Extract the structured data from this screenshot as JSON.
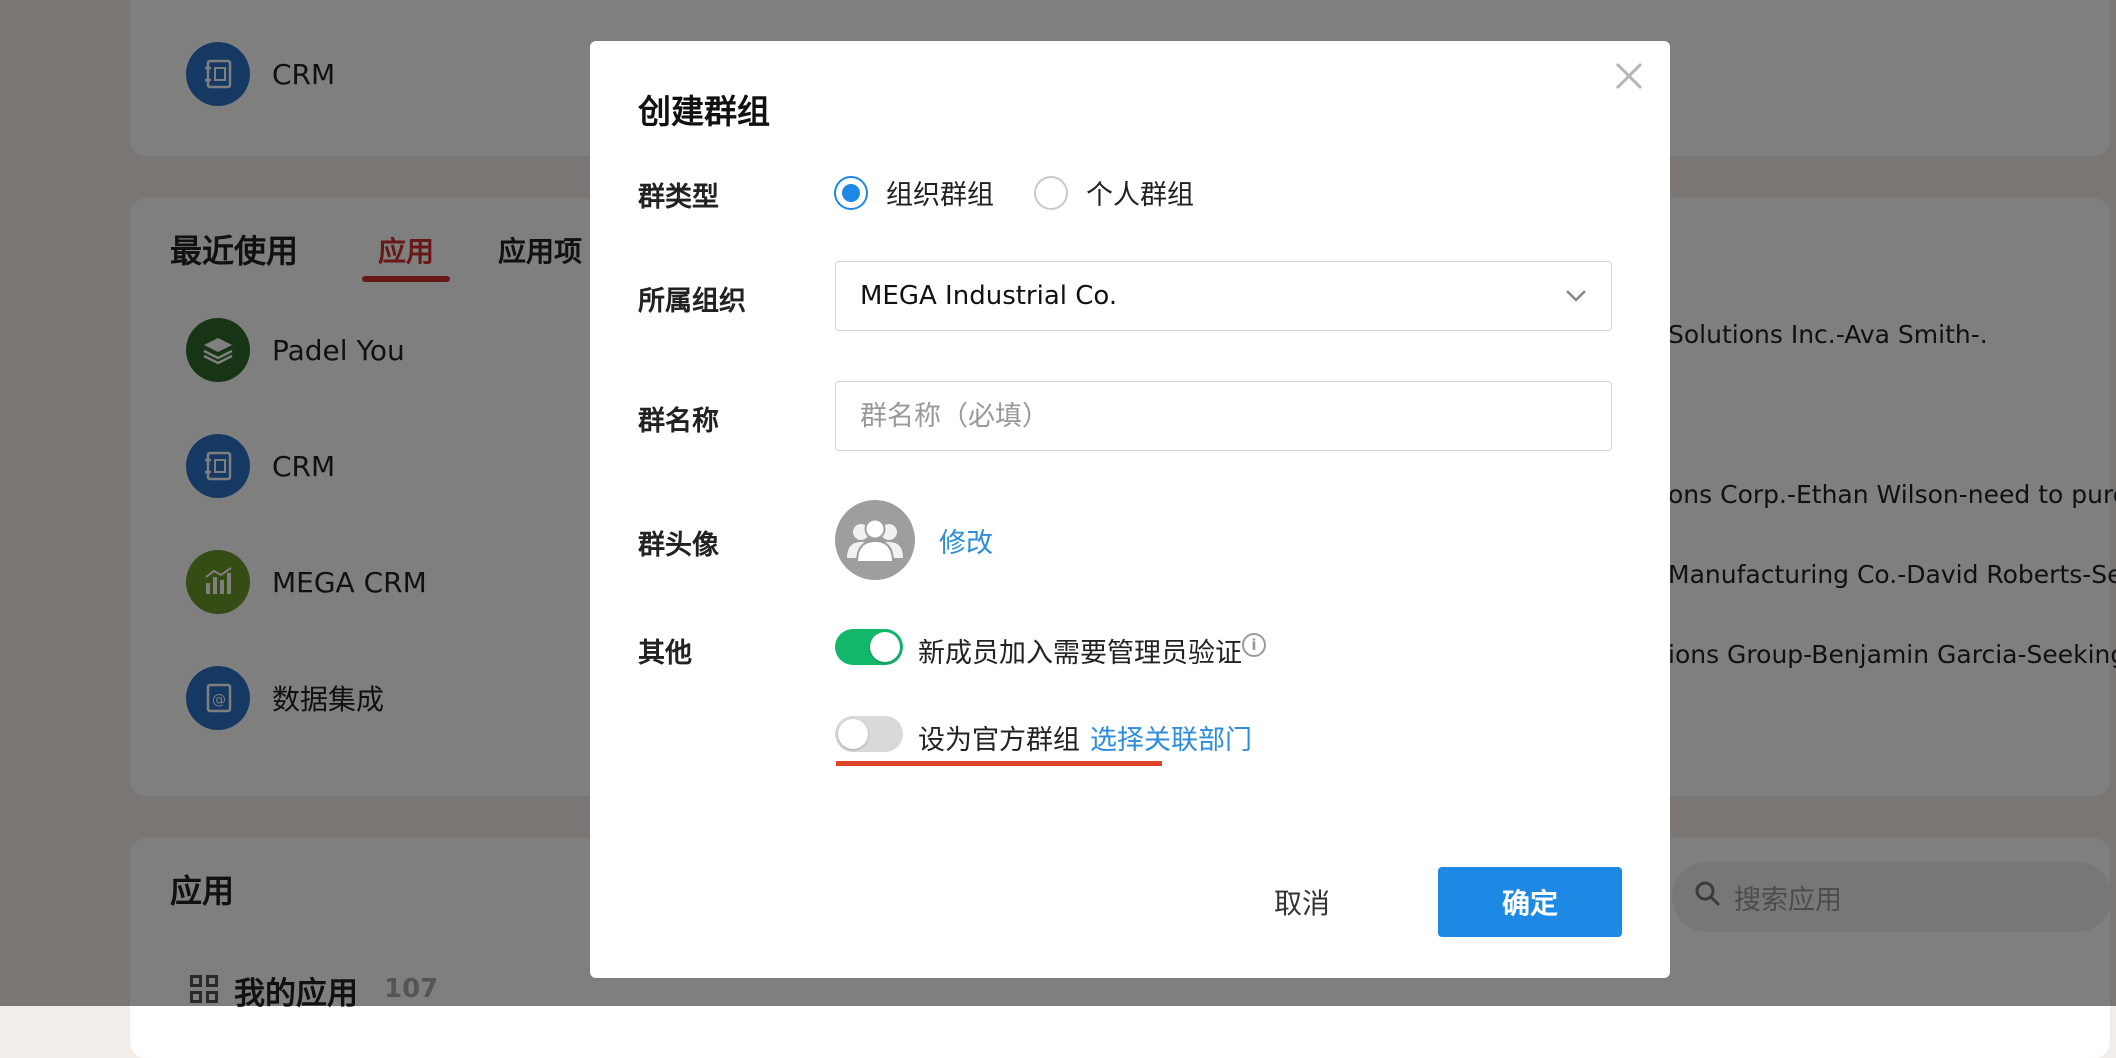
{
  "background": {
    "top_app": {
      "label": "CRM",
      "icon": "ledger-icon",
      "color": "#2b72c4"
    },
    "recent": {
      "title": "最近使用",
      "tabs": [
        {
          "label": "应用",
          "active": true
        },
        {
          "label": "应用项",
          "active": false
        }
      ],
      "apps": [
        {
          "label": "Padel You",
          "icon": "layers-icon",
          "color": "#2f6b2a"
        },
        {
          "label": "CRM",
          "icon": "ledger-icon",
          "color": "#2b72c4"
        },
        {
          "label": "MEGA CRM",
          "icon": "bar-chart-icon",
          "color": "#6b9a2a"
        },
        {
          "label": "数据集成",
          "icon": "at-book-icon",
          "color": "#2b72c4"
        }
      ],
      "right_items": [
        "Solutions Inc.-Ava Smith-.",
        "ons Corp.-Ethan Wilson-need to purcha",
        "Manufacturing Co.-David Roberts-Seek",
        "ions Group-Benjamin Garcia-Seeking f"
      ]
    },
    "apps_section": {
      "title": "应用",
      "search_placeholder": "搜索应用",
      "my_apps_label": "我的应用",
      "my_apps_count": "107"
    }
  },
  "modal": {
    "title": "创建群组",
    "group_type": {
      "label": "群类型",
      "options": [
        {
          "label": "组织群组",
          "checked": true
        },
        {
          "label": "个人群组",
          "checked": false
        }
      ]
    },
    "organization": {
      "label": "所属组织",
      "value": "MEGA Industrial Co."
    },
    "group_name": {
      "label": "群名称",
      "placeholder": "群名称（必填）"
    },
    "avatar": {
      "label": "群头像",
      "edit_link": "修改"
    },
    "other": {
      "label": "其他",
      "admin_verify": {
        "text": "新成员加入需要管理员验证",
        "enabled": true
      },
      "official": {
        "text": "设为官方群组",
        "enabled": false,
        "link": "选择关联部门"
      }
    },
    "actions": {
      "cancel": "取消",
      "confirm": "确定"
    },
    "colors": {
      "primary": "#1e88e5",
      "switch_on": "#12b76a",
      "highlight": "#e04428"
    }
  }
}
